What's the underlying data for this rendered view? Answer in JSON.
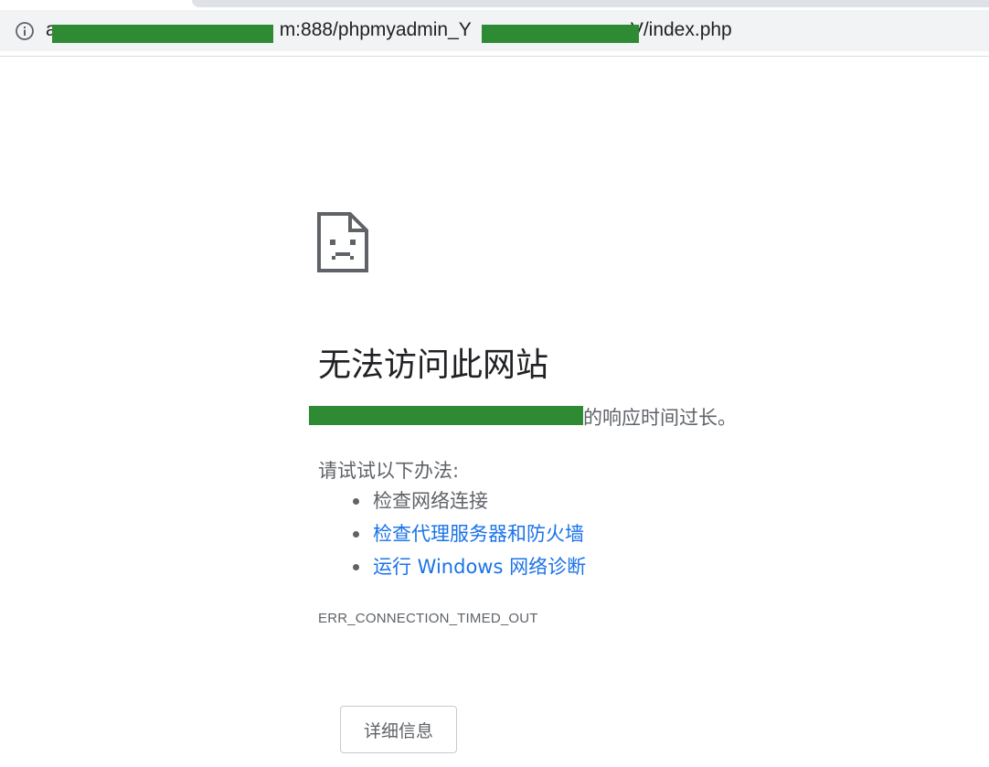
{
  "address_bar": {
    "url_prefix": "a",
    "url_middle": "m:888/phpmyadmin_Y",
    "url_suffix": "V/index.php",
    "info_icon": "info-icon"
  },
  "error_page": {
    "icon": "sad-page-icon",
    "heading": "无法访问此网站",
    "message_suffix": "的响应时间过长。",
    "try_label": "请试试以下办法:",
    "suggestions": [
      {
        "text": "检查网络连接",
        "link": false
      },
      {
        "text": "检查代理服务器和防火墙",
        "link": true
      },
      {
        "text": "运行 Windows 网络诊断",
        "link": true
      }
    ],
    "error_code": "ERR_CONNECTION_TIMED_OUT",
    "details_button": "详细信息"
  },
  "colors": {
    "link": "#1a73e8",
    "secondary_text": "#5f6368",
    "redaction": "#2e8b34"
  }
}
